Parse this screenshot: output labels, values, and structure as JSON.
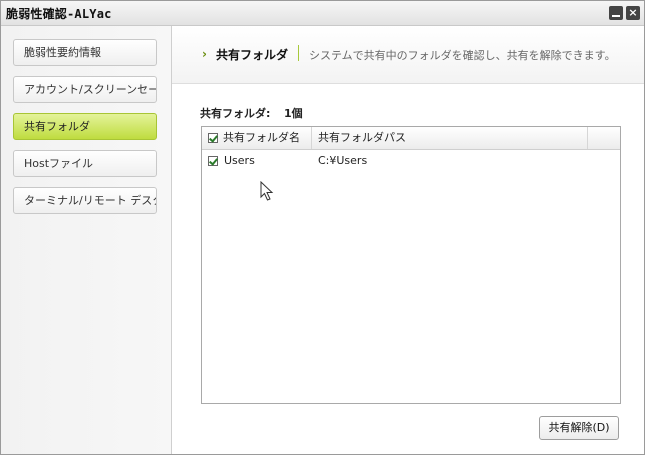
{
  "window": {
    "title": "脆弱性確認-ALYac",
    "close_glyph": "×"
  },
  "sidebar": {
    "items": [
      {
        "label": "脆弱性要約情報"
      },
      {
        "label": "アカウント/スクリーンセーバー"
      },
      {
        "label": "共有フォルダ",
        "active": true
      },
      {
        "label": "Hostファイル"
      },
      {
        "label": "ターミナル/リモート デスクトップ"
      }
    ]
  },
  "header": {
    "arrow": "›",
    "title": "共有フォルダ",
    "description": "システムで共有中のフォルダを確認し、共有を解除できます。"
  },
  "summary": {
    "label": "共有フォルダ:",
    "count": "1個"
  },
  "table": {
    "columns": [
      "共有フォルダ名",
      "共有フォルダパス"
    ],
    "header_checked": true,
    "rows": [
      {
        "name": "Users",
        "path": "C:¥Users",
        "checked": true
      }
    ]
  },
  "actions": {
    "unshare_label": "共有解除(D)"
  },
  "colors": {
    "accent_green": "#bfdc3f",
    "check_green": "#2a7a2a"
  }
}
